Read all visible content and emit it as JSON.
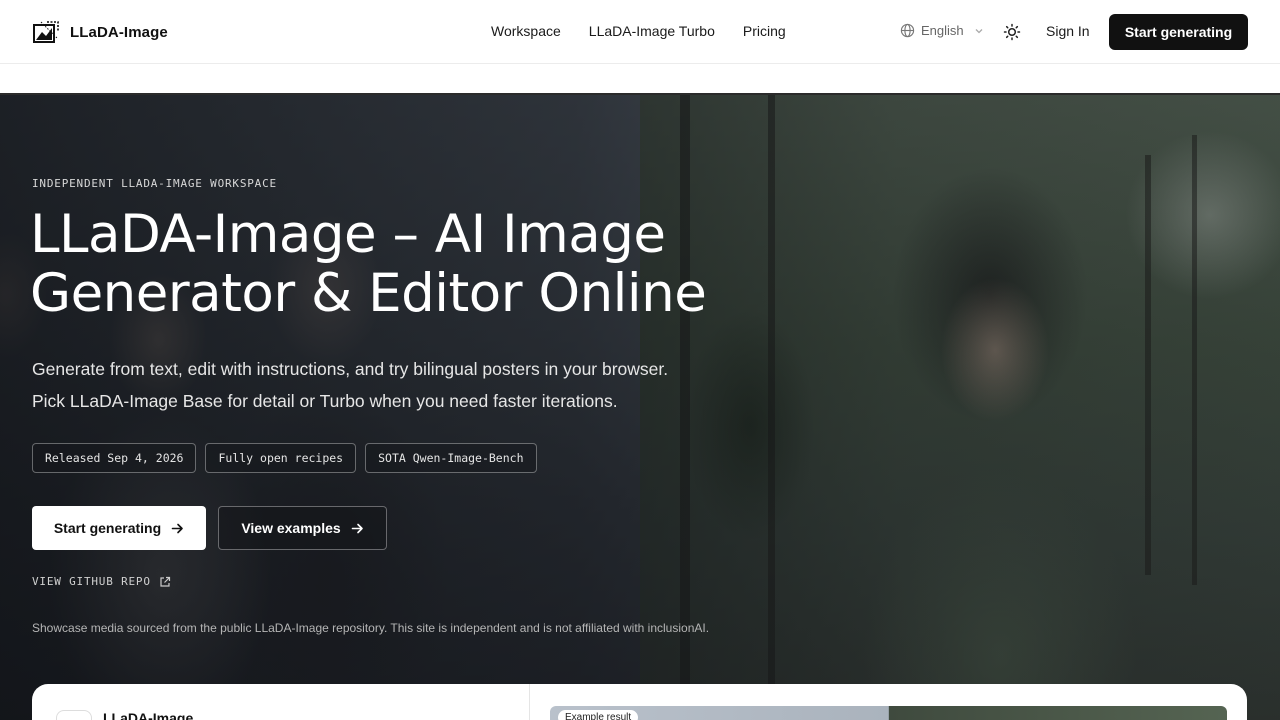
{
  "nav": {
    "brand": "LLaDA-Image",
    "links": [
      {
        "label": "Workspace"
      },
      {
        "label": "LLaDA-Image Turbo"
      },
      {
        "label": "Pricing"
      }
    ],
    "language": "English",
    "sign_in": "Sign In",
    "cta": "Start generating",
    "icons": {
      "language": "globe-icon",
      "theme": "sun-icon",
      "dropdown": "chevron-down-icon"
    }
  },
  "hero": {
    "eyebrow": "INDEPENDENT LLADA-IMAGE WORKSPACE",
    "title_line1": "LLaDA-Image – AI Image",
    "title_line2": "Generator & Editor Online",
    "subtitle_line1": "Generate from text, edit with instructions, and try bilingual posters in your browser.",
    "subtitle_line2": "Pick LLaDA-Image Base for detail or Turbo when you need faster iterations.",
    "chips": [
      {
        "label": "Released Sep 4, 2026"
      },
      {
        "label": "Fully open recipes"
      },
      {
        "label": "SOTA Qwen-Image-Bench"
      }
    ],
    "primary_button": "Start generating",
    "secondary_button": "View examples",
    "github_link": "VIEW GITHUB REPO",
    "disclaimer": "Showcase media sourced from the public LLaDA-Image repository. This site is independent and is not affiliated with inclusionAI."
  },
  "card": {
    "title": "LLaDA-Image",
    "example_badge": "Example result"
  },
  "colors": {
    "primary_dark": "#111111",
    "text_on_dark": "#ffffff",
    "muted": "#666666"
  }
}
